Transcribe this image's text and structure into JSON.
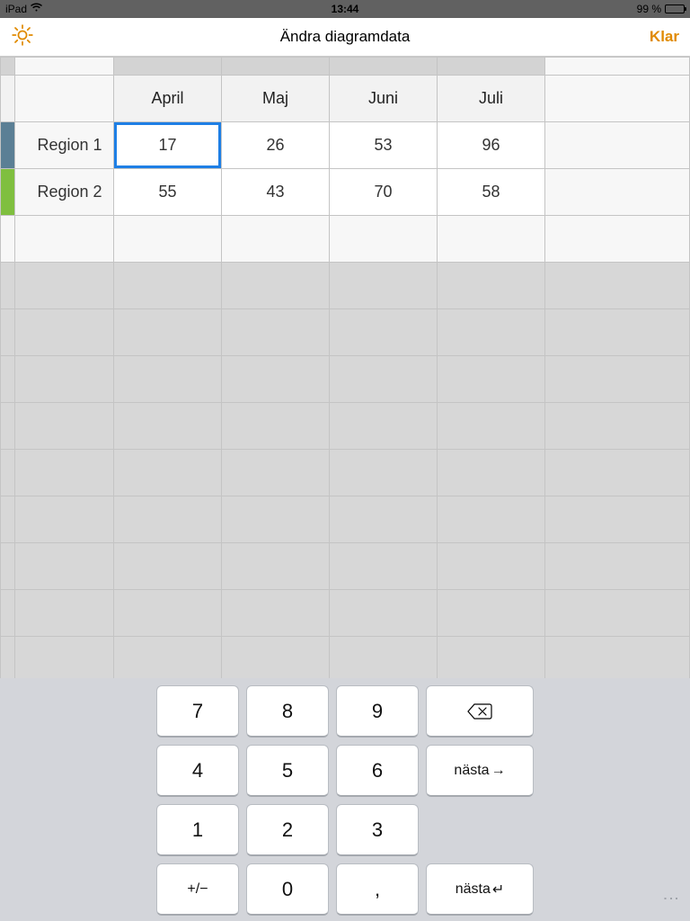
{
  "statusbar": {
    "device": "iPad",
    "time": "13:44",
    "battery_text": "99 %"
  },
  "navbar": {
    "title": "Ändra diagramdata",
    "done": "Klar"
  },
  "table": {
    "columns": [
      "April",
      "Maj",
      "Juni",
      "Juli"
    ],
    "rows": [
      {
        "label": "Region 1",
        "values": [
          "17",
          "26",
          "53",
          "96"
        ],
        "color": "blue"
      },
      {
        "label": "Region 2",
        "values": [
          "55",
          "43",
          "70",
          "58"
        ],
        "color": "green"
      }
    ],
    "selected": {
      "row": 0,
      "col": 0
    }
  },
  "keypad": {
    "keys": [
      [
        "7",
        "8",
        "9",
        "⌫"
      ],
      [
        "4",
        "5",
        "6",
        "nästa→"
      ],
      [
        "1",
        "2",
        "3",
        ""
      ],
      [
        "+/−",
        "0",
        ",",
        "nästa↵"
      ]
    ],
    "next_right": "nästa",
    "next_return": "nästa"
  }
}
